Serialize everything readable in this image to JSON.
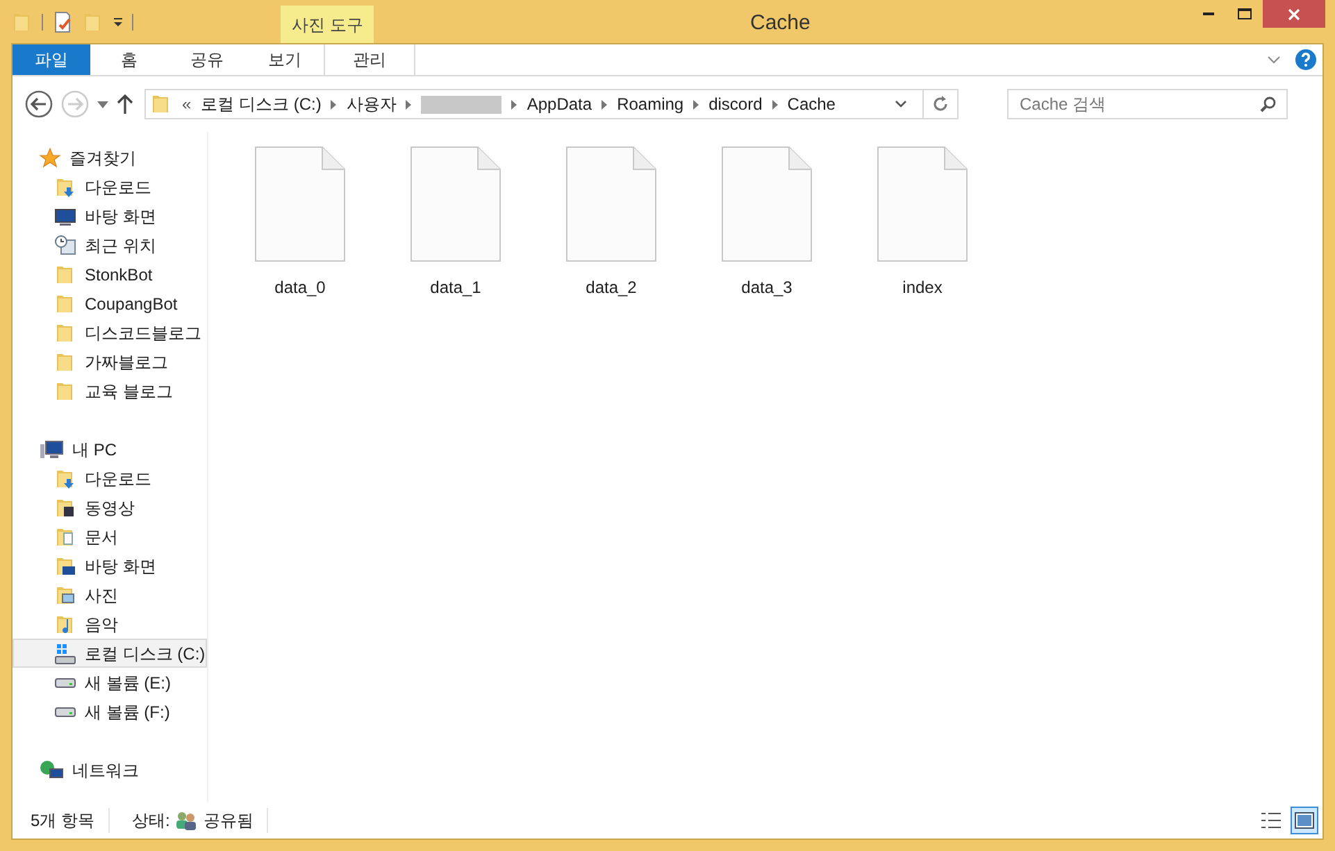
{
  "window": {
    "title": "Cache"
  },
  "ribbon": {
    "context_label": "사진 도구",
    "tabs": [
      {
        "label": "파일",
        "kind": "file",
        "selected": false
      },
      {
        "label": "홈",
        "kind": "tab",
        "selected": false
      },
      {
        "label": "공유",
        "kind": "tab",
        "selected": false
      },
      {
        "label": "보기",
        "kind": "tab",
        "selected": false
      },
      {
        "label": "관리",
        "kind": "context",
        "selected": false
      }
    ]
  },
  "address": {
    "overflow_mark": "«",
    "path": [
      {
        "kind": "text",
        "label": "로컬 디스크 (C:)"
      },
      {
        "kind": "text",
        "label": "사용자"
      },
      {
        "kind": "redacted"
      },
      {
        "kind": "text",
        "label": "AppData"
      },
      {
        "kind": "text",
        "label": "Roaming"
      },
      {
        "kind": "text",
        "label": "discord"
      },
      {
        "kind": "text",
        "label": "Cache"
      }
    ]
  },
  "search": {
    "placeholder": "Cache 검색"
  },
  "sidebar": {
    "sections": [
      {
        "label": "즐겨찾기",
        "kind": "star",
        "children": [
          {
            "label": "다운로드",
            "kind": "download",
            "selected": false
          },
          {
            "label": "바탕 화면",
            "kind": "desktop",
            "selected": false
          },
          {
            "label": "최근 위치",
            "kind": "recent",
            "selected": false
          },
          {
            "label": "StonkBot",
            "kind": "folder",
            "selected": false
          },
          {
            "label": "CoupangBot",
            "kind": "folder",
            "selected": false
          },
          {
            "label": "디스코드블로그",
            "kind": "folder",
            "selected": false
          },
          {
            "label": "가짜블로그",
            "kind": "folder",
            "selected": false
          },
          {
            "label": "교육 블로그",
            "kind": "folder",
            "selected": false
          }
        ]
      },
      {
        "label": "내 PC",
        "kind": "pc",
        "children": [
          {
            "label": "다운로드",
            "kind": "download",
            "selected": false
          },
          {
            "label": "동영상",
            "kind": "video",
            "selected": false
          },
          {
            "label": "문서",
            "kind": "document",
            "selected": false
          },
          {
            "label": "바탕 화면",
            "kind": "desktop-folder",
            "selected": false
          },
          {
            "label": "사진",
            "kind": "picture-folder",
            "selected": false
          },
          {
            "label": "음악",
            "kind": "music",
            "selected": false
          },
          {
            "label": "로컬 디스크 (C:)",
            "kind": "system-drive",
            "selected": true
          },
          {
            "label": "새 볼륨 (E:)",
            "kind": "drive",
            "selected": false
          },
          {
            "label": "새 볼륨 (F:)",
            "kind": "drive",
            "selected": false
          }
        ]
      },
      {
        "label": "네트워크",
        "kind": "network"
      }
    ]
  },
  "files": [
    {
      "name": "data_0"
    },
    {
      "name": "data_1"
    },
    {
      "name": "data_2"
    },
    {
      "name": "data_3"
    },
    {
      "name": "index"
    }
  ],
  "status_bar": {
    "item_count": "5개 항목",
    "state_label": "상태:",
    "state_value": "공유됨"
  },
  "views": [
    {
      "kind": "details",
      "selected": false
    },
    {
      "kind": "large-icons",
      "selected": true
    }
  ]
}
